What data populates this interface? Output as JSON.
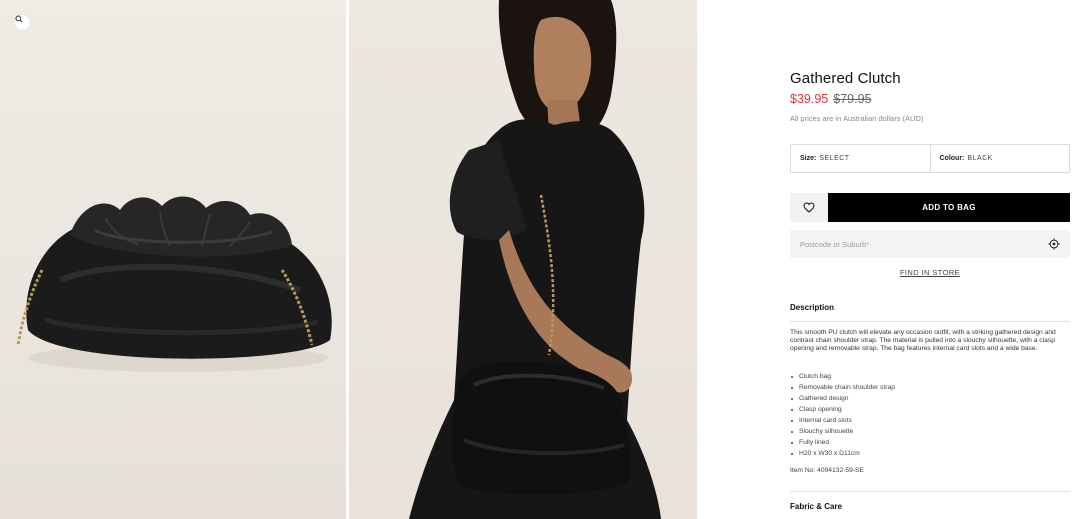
{
  "gallery": {
    "zoom_icon": "magnifier-icon",
    "images": [
      {
        "alt": "black gathered clutch bag"
      },
      {
        "alt": "model wearing black dress carrying clutch with chain strap"
      }
    ]
  },
  "product": {
    "title": "Gathered Clutch",
    "price_sale": "$39.95",
    "price_original": "$79.95",
    "currency_note": "All prices are in Australian dollars (AUD)",
    "colors": {
      "sale": "#e2333f",
      "button": "#000000"
    }
  },
  "selectors": {
    "size_label": "Size:",
    "size_value": "SELECT",
    "colour_label": "Colour:",
    "colour_value": "BLACK"
  },
  "actions": {
    "wishlist_icon": "heart-icon",
    "add_to_bag": "ADD TO BAG",
    "postcode_placeholder": "Postcode or Suburb*",
    "location_icon": "crosshair-icon",
    "find_in_store": "FIND IN STORE"
  },
  "description": {
    "heading": "Description",
    "body": "This smooth PU clutch will elevate any occasion outfit, with a striking gathered design and contrast chain shoulder strap. The material is pulled into a slouchy silhouette, with a clasp opening and removable strap. The bag features internal card slots and a wide base.",
    "bullets": [
      "Clutch bag",
      "Removable chain shoulder strap",
      "Gathered design",
      "Clasp opening",
      "Internal card slots",
      "Slouchy silhouette",
      "Fully lined",
      "H20 x W30 x D11cm"
    ],
    "item_no": "Item No: 4094132-59-SE"
  },
  "fabric": {
    "heading": "Fabric & Care"
  }
}
